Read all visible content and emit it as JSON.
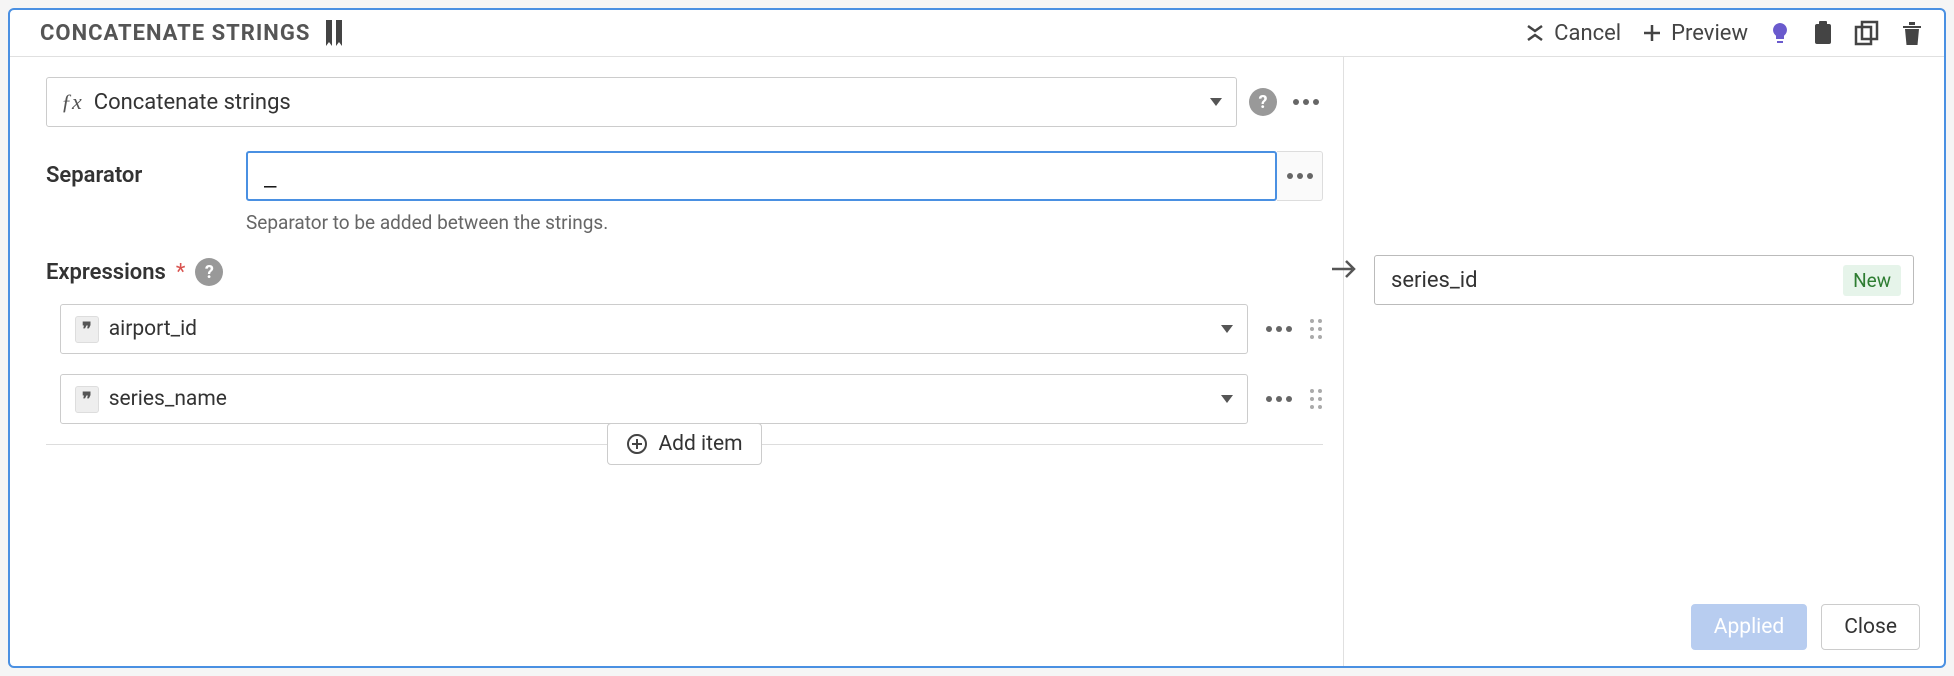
{
  "header": {
    "title": "CONCATENATE STRINGS",
    "cancel": "Cancel",
    "preview": "Preview"
  },
  "processor": {
    "label": "Concatenate strings"
  },
  "separator": {
    "label": "Separator",
    "value": "_",
    "help": "Separator to be added between the strings."
  },
  "expressions": {
    "label": "Expressions",
    "items": [
      {
        "type_badge": "❞",
        "name": "airport_id"
      },
      {
        "type_badge": "❞",
        "name": "series_name"
      }
    ],
    "add_label": "Add item"
  },
  "output": {
    "name": "series_id",
    "badge": "New"
  },
  "footer": {
    "applied": "Applied",
    "close": "Close"
  }
}
